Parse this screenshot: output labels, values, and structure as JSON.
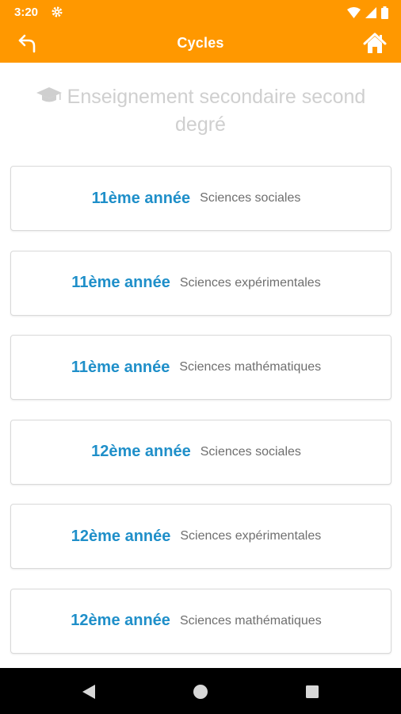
{
  "status_bar": {
    "time": "3:20",
    "icons": [
      "gear-icon",
      "wifi-icon",
      "signal-icon",
      "battery-icon"
    ]
  },
  "app_bar": {
    "title": "Cycles",
    "back_icon": "back-arrow-icon",
    "home_icon": "home-icon",
    "color": "#ff9800"
  },
  "section": {
    "icon": "graduation-cap-icon",
    "title": "Enseignement secondaire second degré"
  },
  "cycles": [
    {
      "year": "11ème année",
      "stream": "Sciences sociales"
    },
    {
      "year": "11ème année",
      "stream": "Sciences expérimentales"
    },
    {
      "year": "11ème année",
      "stream": "Sciences mathématiques"
    },
    {
      "year": "12ème année",
      "stream": "Sciences sociales"
    },
    {
      "year": "12ème année",
      "stream": "Sciences expérimentales"
    },
    {
      "year": "12ème année",
      "stream": "Sciences mathématiques"
    }
  ],
  "nav_bar": {
    "icons": [
      "back-triangle-icon",
      "home-circle-icon",
      "recents-square-icon"
    ]
  },
  "colors": {
    "accent": "#ff9800",
    "year_text": "#1f8fc9",
    "heading_text": "#cfcfcf"
  }
}
